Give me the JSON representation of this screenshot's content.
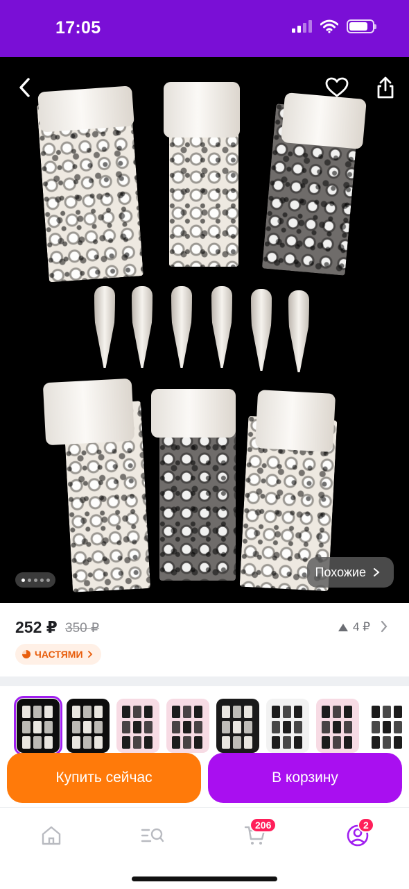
{
  "status_bar": {
    "time": "17:05",
    "battery_level": 0.8,
    "icons": [
      "signal-icon",
      "wifi-icon",
      "battery-icon"
    ]
  },
  "product_image": {
    "back_icon": "chevron-left-icon",
    "favorite_icon": "heart-icon",
    "share_icon": "share-icon",
    "carousel": {
      "total": 5,
      "active": 0
    },
    "similar_label": "Похожие",
    "similar_icon": "chevron-right-icon"
  },
  "price": {
    "current": "252 ₽",
    "old": "350 ₽",
    "bonus": "4 ₽",
    "bonus_icon": "triangle-up-icon",
    "parts_label": "ЧАСТЯМИ",
    "parts_icon": "pie-icon"
  },
  "variants": {
    "count": 8,
    "selected": 0,
    "backgrounds": [
      "#0d0d0d",
      "#0d0d0d",
      "#f7dbe4",
      "#f7dbe4",
      "#1a1a1a",
      "#f2f2f2",
      "#f7dbe4",
      "#ffffff"
    ]
  },
  "actions": {
    "buy_now": "Купить сейчас",
    "add_to_cart": "В корзину"
  },
  "bottom_nav": {
    "items": [
      {
        "name": "home",
        "icon": "home-icon"
      },
      {
        "name": "catalog",
        "icon": "catalog-search-icon"
      },
      {
        "name": "cart",
        "icon": "cart-icon",
        "badge": "206"
      },
      {
        "name": "profile",
        "icon": "profile-icon",
        "badge": "2"
      }
    ]
  },
  "colors": {
    "brand_purple": "#7a0fd6",
    "buy_orange": "#ff7a0a",
    "cart_purple": "#a90ff0",
    "badge_red": "#ff1f5a",
    "parts_orange": "#e85d0c"
  }
}
